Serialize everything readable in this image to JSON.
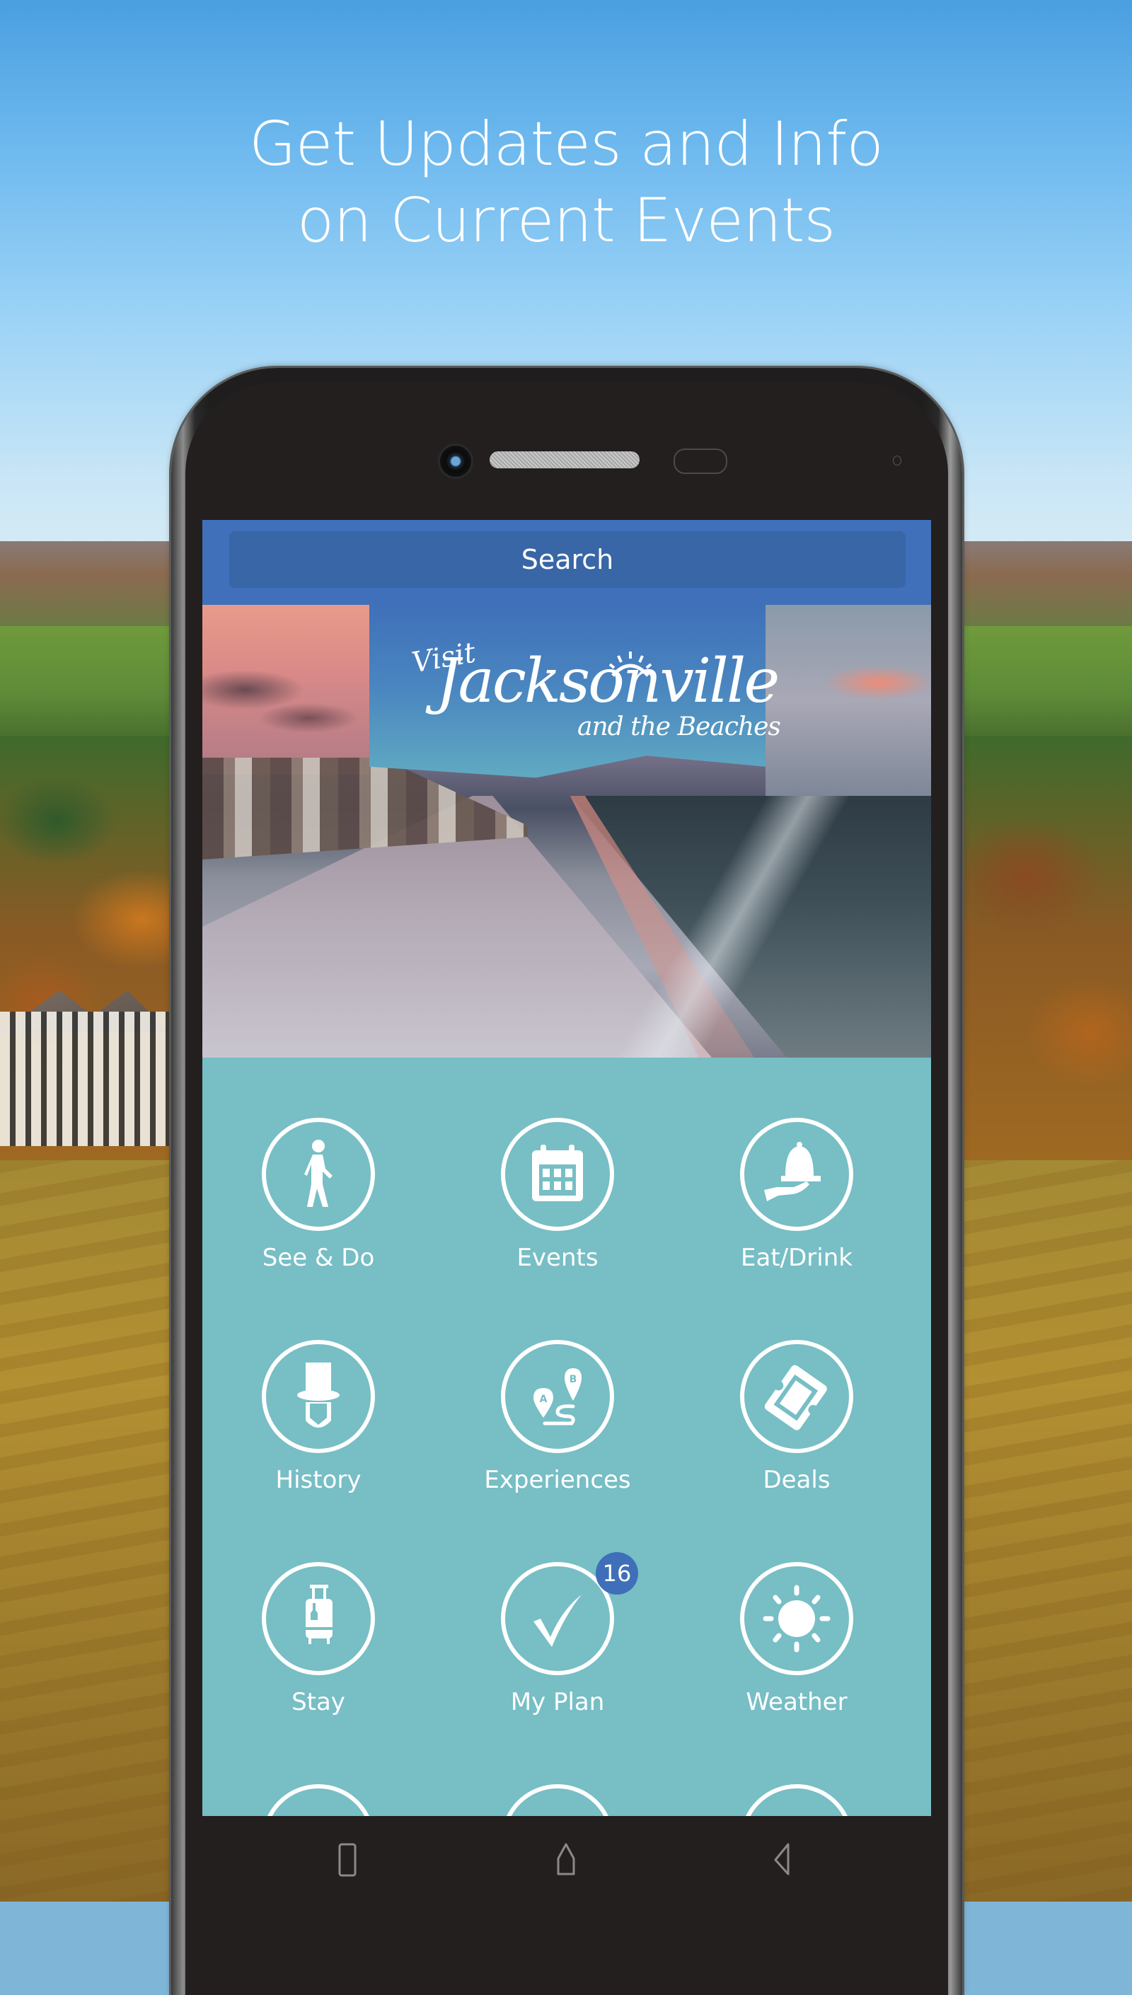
{
  "promo": {
    "headline_line1": "Get Updates and Info",
    "headline_line2": "on Current Events"
  },
  "app": {
    "search": {
      "label": "Search"
    },
    "logo": {
      "visit": "Visit",
      "name": "Jacksonville",
      "tagline": "and the Beaches"
    },
    "hero_image": "beach-aerial-sunset",
    "tiles": [
      {
        "label": "See & Do",
        "icon": "walking-person-icon"
      },
      {
        "label": "Events",
        "icon": "calendar-icon"
      },
      {
        "label": "Eat/Drink",
        "icon": "serving-cloche-icon"
      },
      {
        "label": "History",
        "icon": "top-hat-beard-icon"
      },
      {
        "label": "Experiences",
        "icon": "route-a-to-b-icon"
      },
      {
        "label": "Deals",
        "icon": "ticket-icon"
      },
      {
        "label": "Stay",
        "icon": "luggage-icon"
      },
      {
        "label": "My Plan",
        "icon": "checkmark-icon",
        "badge": "16"
      },
      {
        "label": "Weather",
        "icon": "sun-icon"
      }
    ],
    "colors": {
      "header_blue": "#3f70b9",
      "search_field": "#3866a6",
      "tile_background": "#77bec5",
      "badge": "#3f6fb9"
    }
  },
  "device": {
    "nav": {
      "recents": "recents-square-icon",
      "home": "home-icon",
      "back": "back-triangle-icon"
    }
  }
}
